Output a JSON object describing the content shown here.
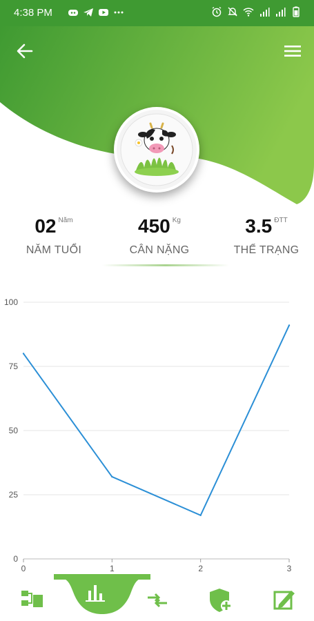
{
  "status_bar": {
    "time": "4:38 PM",
    "left_icons": [
      "discord-icon",
      "telegram-icon",
      "youtube-icon",
      "more-dots-icon"
    ],
    "right_icons": [
      "alarm-icon",
      "mute-icon",
      "wifi-icon",
      "signal-icon",
      "signal-icon",
      "battery-icon"
    ]
  },
  "header": {
    "back_icon": "back-arrow-icon",
    "menu_icon": "hamburger-menu-icon",
    "avatar": "cow-avatar-image"
  },
  "stats": [
    {
      "value": "02",
      "unit": "Năm",
      "label": "NĂM TUỔI"
    },
    {
      "value": "450",
      "unit": "Kg",
      "label": "CÂN NẶNG"
    },
    {
      "value": "3.5",
      "unit": "ĐTT",
      "label": "THỂ TRẠNG"
    }
  ],
  "chart_data": {
    "type": "line",
    "x": [
      0,
      1,
      2,
      3
    ],
    "series": [
      {
        "values": [
          80,
          32,
          17,
          91
        ]
      }
    ],
    "xlim": [
      0,
      3
    ],
    "ylim": [
      0,
      100
    ],
    "yticks": [
      0,
      25,
      50,
      75,
      100
    ],
    "xticks": [
      0,
      1,
      2,
      3
    ],
    "grid": true,
    "line_color": "#2b8fd6"
  },
  "bottom_nav": {
    "items": [
      "hierarchy-icon",
      "bar-chart-icon",
      "transfer-arrows-icon",
      "shield-plus-icon",
      "edit-document-icon"
    ],
    "active_index": 1,
    "accent": "#6fbf4a"
  },
  "colors": {
    "header_dark": "#3f9a32",
    "header_light": "#8cc84b"
  }
}
